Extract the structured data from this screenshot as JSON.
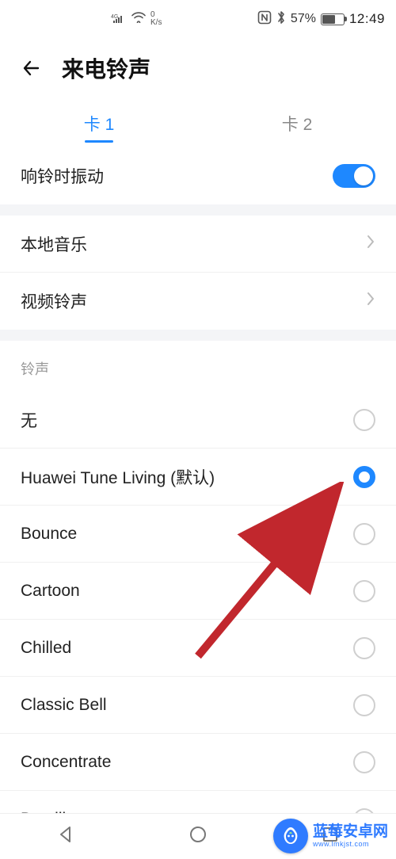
{
  "status": {
    "speed_top": "0",
    "speed_bottom": "K/s",
    "battery_percent": "57%",
    "time": "12:49"
  },
  "header": {
    "title": "来电铃声"
  },
  "tabs": {
    "sim1": "卡 1",
    "sim2": "卡 2"
  },
  "settings": {
    "vibrate_label": "响铃时振动",
    "local_music": "本地音乐",
    "video_ringtone": "视频铃声"
  },
  "ringtone_section": {
    "title": "铃声",
    "items": [
      {
        "label": "无",
        "selected": false
      },
      {
        "label": "Huawei Tune Living (默认)",
        "selected": true
      },
      {
        "label": "Bounce",
        "selected": false
      },
      {
        "label": "Cartoon",
        "selected": false
      },
      {
        "label": "Chilled",
        "selected": false
      },
      {
        "label": "Classic Bell",
        "selected": false
      },
      {
        "label": "Concentrate",
        "selected": false
      },
      {
        "label": "Day lily",
        "selected": false
      }
    ]
  },
  "watermark": {
    "text": "蓝莓安卓网",
    "url": "www.lmkjst.com"
  },
  "colors": {
    "accent": "#1e88ff",
    "arrow": "#c1272d"
  }
}
